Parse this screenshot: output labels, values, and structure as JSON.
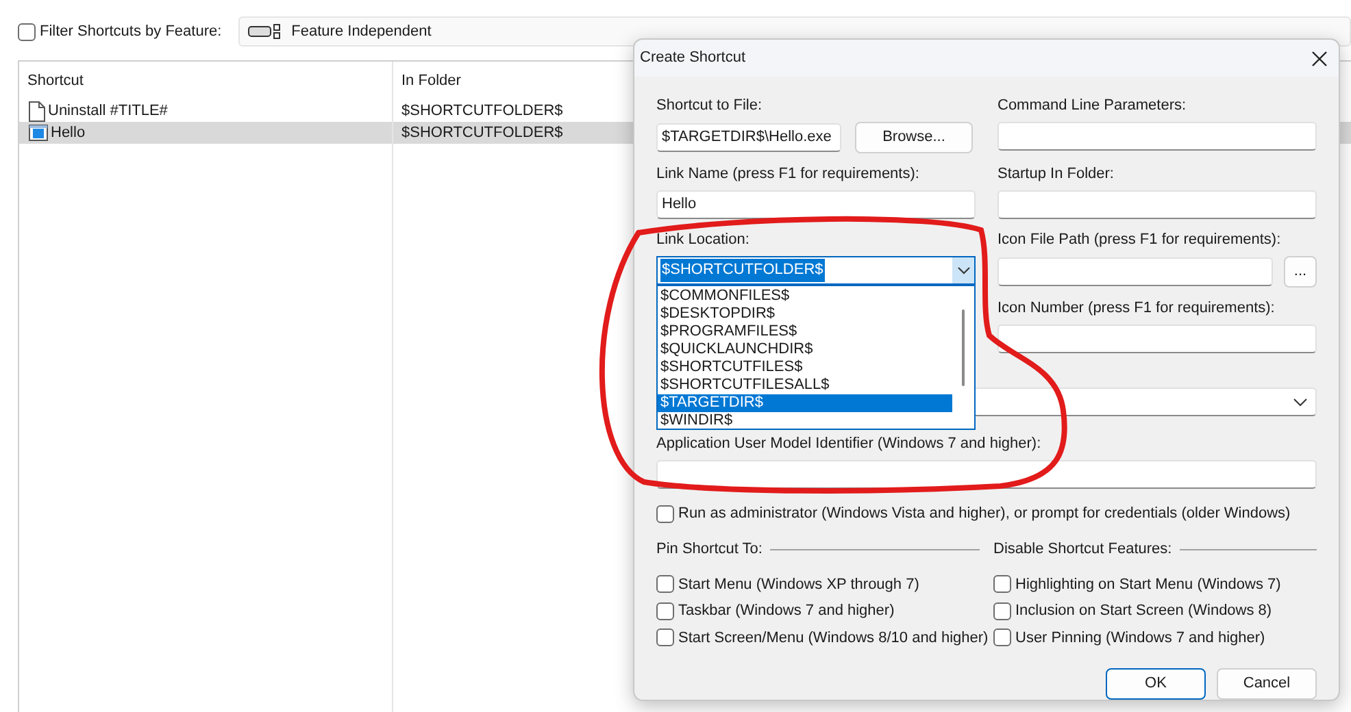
{
  "toolbar": {
    "filter": {
      "label": "Filter Shortcuts by Feature:",
      "checked": false
    },
    "feature": "Feature Independent"
  },
  "table": {
    "columns": [
      "Shortcut",
      "In Folder"
    ],
    "rows": [
      {
        "kind": "document",
        "shortcut": "Uninstall #TITLE#",
        "folder": "$SHORTCUTFOLDER$",
        "selected": false
      },
      {
        "kind": "application",
        "shortcut": "Hello",
        "folder": "$SHORTCUTFOLDER$",
        "selected": true
      }
    ]
  },
  "dialog": {
    "title": "Create Shortcut",
    "shortcut_to_file": {
      "label": "Shortcut to File:",
      "value": "$TARGETDIR$\\Hello.exe"
    },
    "browse_button": "Browse...",
    "command_line": {
      "label": "Command Line Parameters:"
    },
    "link_name": {
      "label": "Link Name (press F1 for requirements):",
      "value": "Hello"
    },
    "startup_folder": {
      "label": "Startup In Folder:"
    },
    "link_location": {
      "label": "Link Location:",
      "value": "$SHORTCUTFOLDER$",
      "expanded": true,
      "options": [
        {
          "text": "$COMMONFILES$",
          "selected": false
        },
        {
          "text": "$DESKTOPDIR$",
          "selected": false
        },
        {
          "text": "$PROGRAMFILES$",
          "selected": false
        },
        {
          "text": "$QUICKLAUNCHDIR$",
          "selected": false
        },
        {
          "text": "$SHORTCUTFILES$",
          "selected": false
        },
        {
          "text": "$SHORTCUTFILESALL$",
          "selected": false
        },
        {
          "text": "$TARGETDIR$",
          "selected": true
        },
        {
          "text": "$WINDIR$",
          "selected": false
        }
      ]
    },
    "icon_file_path": {
      "label": "Icon File Path (press F1 for requirements):"
    },
    "icon_browse_button": "...",
    "icon_number": {
      "label": "Icon Number (press F1 for requirements):"
    },
    "aumid": {
      "label": "Application User Model Identifier (Windows 7 and higher):"
    },
    "run_as_admin": {
      "label": "Run as administrator (Windows Vista and higher), or prompt for credentials (older Windows)",
      "checked": false
    },
    "pin_group": {
      "title": "Pin Shortcut To:",
      "options": [
        {
          "label": "Start Menu (Windows XP through 7)",
          "checked": false
        },
        {
          "label": "Taskbar (Windows 7 and higher)",
          "checked": false
        },
        {
          "label": "Start Screen/Menu (Windows 8/10 and higher)",
          "checked": false
        }
      ]
    },
    "disable_group": {
      "title": "Disable Shortcut Features:",
      "options": [
        {
          "label": "Highlighting on Start Menu (Windows 7)",
          "checked": false
        },
        {
          "label": "Inclusion on Start Screen (Windows 8)",
          "checked": false
        },
        {
          "label": "User Pinning (Windows 7 and higher)",
          "checked": false
        }
      ]
    },
    "ok_button": "OK",
    "cancel_button": "Cancel"
  }
}
